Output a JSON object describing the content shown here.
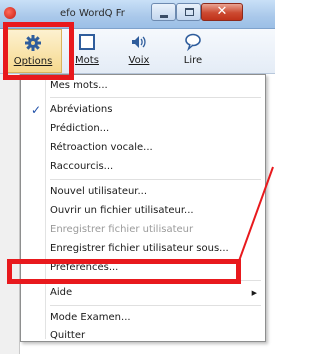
{
  "window": {
    "title": "efo WordQ Fr",
    "close_glyph": "✕"
  },
  "toolbar": {
    "buttons": [
      {
        "label": "Options",
        "icon": "gear-icon"
      },
      {
        "label": "Mots",
        "icon": "square-icon"
      },
      {
        "label": "Voix",
        "icon": "speaker-icon"
      },
      {
        "label": "Lire",
        "icon": "speech-bubble-icon"
      }
    ]
  },
  "menu": {
    "items": [
      {
        "label": "Mes mots...",
        "checked": false,
        "disabled": false
      },
      {
        "label": "Abréviations",
        "checked": true,
        "disabled": false
      },
      {
        "label": "Prédiction...",
        "checked": false,
        "disabled": false
      },
      {
        "label": "Rétroaction vocale...",
        "checked": false,
        "disabled": false
      },
      {
        "label": "Raccourcis...",
        "checked": false,
        "disabled": false
      },
      {
        "label": "Nouvel utilisateur...",
        "checked": false,
        "disabled": false
      },
      {
        "label": "Ouvrir un fichier utilisateur...",
        "checked": false,
        "disabled": false,
        "highlighted": true
      },
      {
        "label": "Enregistrer fichier utilisateur",
        "checked": false,
        "disabled": true
      },
      {
        "label": "Enregistrer fichier utilisateur sous...",
        "checked": false,
        "disabled": false
      },
      {
        "label": "Préférences...",
        "checked": false,
        "disabled": false
      },
      {
        "label": "Aide",
        "checked": false,
        "disabled": false,
        "submenu": true
      },
      {
        "label": "Mode Examen...",
        "checked": false,
        "disabled": false
      },
      {
        "label": "Quitter",
        "checked": false,
        "disabled": false
      }
    ],
    "check_glyph": "✓",
    "submenu_glyph": "▶"
  },
  "colors": {
    "highlight": "#e8191d",
    "accent": "#1f4fa8"
  }
}
